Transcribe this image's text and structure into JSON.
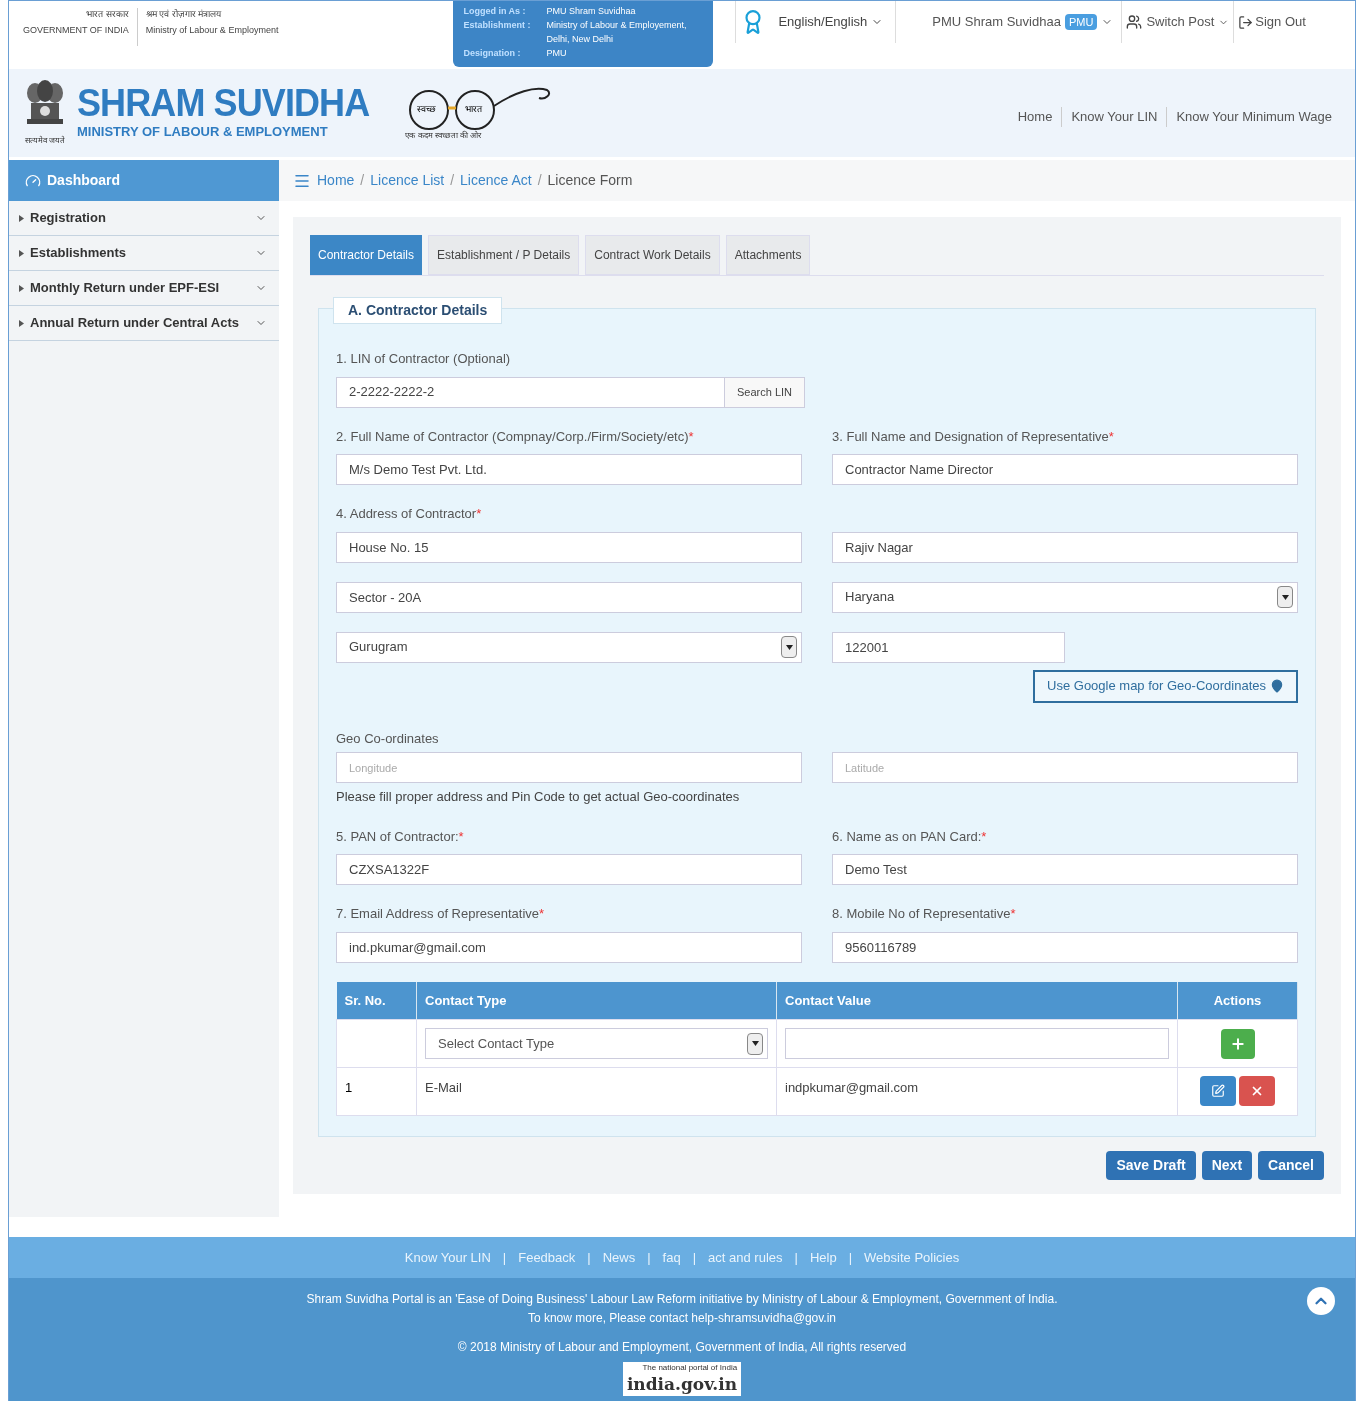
{
  "gov": {
    "hindi": "भारत सरकार",
    "english": "GOVERNMENT OF INDIA"
  },
  "ministry": {
    "hindi": "श्रम एवं रोज़गार मंत्रालय",
    "english": "Ministry of Labour & Employment"
  },
  "login_info": [
    {
      "label": "Logged in As :",
      "value": "PMU Shram Suvidhaa"
    },
    {
      "label": "Establishment :",
      "value": "Ministry of Labour & Employement, Delhi, New Delhi"
    },
    {
      "label": "Designation :",
      "value": "PMU"
    }
  ],
  "user_bar": {
    "language": "English/English",
    "user": "PMU Shram Suvidhaa",
    "badge": "PMU",
    "switch_post": "Switch Post",
    "sign_out": "Sign Out"
  },
  "brand": {
    "title": "SHRAM SUVIDHA",
    "subtitle": "MINISTRY OF LABOUR & EMPLOYMENT",
    "motto": "सत्यमेव जयते"
  },
  "swachh": {
    "left": "स्वच्छ",
    "right": "भारत",
    "tagline": "एक कदम स्वच्छता की ओर"
  },
  "top_nav": [
    "Home",
    "Know Your LIN",
    "Know Your Minimum Wage"
  ],
  "sidebar": {
    "header": "Dashboard",
    "items": [
      "Registration",
      "Establishments",
      "Monthly Return under EPF-ESI",
      "Annual Return under Central Acts"
    ]
  },
  "breadcrumb": [
    "Home",
    "Licence List",
    "Licence Act",
    "Licence Form"
  ],
  "breadcrumb_separator": "/",
  "required_mark": "*",
  "tabs": [
    {
      "label": "Contractor Details",
      "selected": true
    },
    {
      "label": "Establishment / P Details",
      "selected": false
    },
    {
      "label": "Contract Work Details",
      "selected": false
    },
    {
      "label": "Attachments",
      "selected": false
    }
  ],
  "section_title": "A. Contractor Details",
  "lin": {
    "label": "1. LIN of Contractor (Optional)",
    "value": "2-2222-2222-2",
    "button": "Search LIN"
  },
  "form_rows": [
    [
      {
        "kind": "text",
        "label": "2. Full Name of Contractor (Compnay/Corp./Firm/Society/etc)",
        "required": true,
        "value": "M/s Demo Test Pvt. Ltd."
      },
      {
        "kind": "text",
        "label": "3. Full Name and Designation of Representative",
        "required": true,
        "value": "Contractor Name Director"
      }
    ],
    [
      {
        "kind": "text",
        "label": "4. Address of Contractor",
        "required": true,
        "value": "House No. 15"
      },
      {
        "kind": "text",
        "value": "Rajiv Nagar"
      }
    ],
    [
      {
        "kind": "text",
        "value": "Sector - 20A"
      },
      {
        "kind": "select",
        "value": "Haryana"
      }
    ],
    [
      {
        "kind": "select",
        "value": "Gurugram"
      },
      {
        "kind": "short",
        "value": "122001"
      }
    ]
  ],
  "map_button": "Use Google map for Geo-Coordinates",
  "geo": {
    "label": "Geo Co-ordinates",
    "longitude_placeholder": "Longitude",
    "latitude_placeholder": "Latitude",
    "hint": "Please fill proper address and Pin Code to get actual Geo-coordinates"
  },
  "form_rows_2": [
    [
      {
        "kind": "text",
        "label": "5. PAN of Contractor:",
        "required": true,
        "value": "CZXSA1322F"
      },
      {
        "kind": "text",
        "label": "6. Name as on PAN Card:",
        "required": true,
        "value": "Demo Test"
      }
    ],
    [
      {
        "kind": "text",
        "label": "7. Email Address of Representative",
        "required": true,
        "value": "ind.pkumar@gmail.com"
      },
      {
        "kind": "text",
        "label": "8. Mobile No of Representative",
        "required": true,
        "value": "9560116789"
      }
    ]
  ],
  "contacts": {
    "columns": [
      "Sr. No.",
      "Contact Type",
      "Contact Value",
      "Actions"
    ],
    "type_placeholder": "Select Contact Type",
    "rows": [
      {
        "sr": "1",
        "type": "E-Mail",
        "value": "indpkumar@gmail.com"
      }
    ]
  },
  "actions": [
    "Save Draft",
    "Next",
    "Cancel"
  ],
  "footer": {
    "separator": "|",
    "links": [
      "Know Your LIN",
      "Feedback",
      "News",
      "faq",
      "act and rules",
      "Help",
      "Website Policies"
    ],
    "lines": [
      "Shram Suvidha Portal is an 'Ease of Doing Business' Labour Law Reform initiative by Ministry of Labour & Employment, Government of India.",
      "To know more, Please contact help-shramsuvidha@gov.in"
    ],
    "copyright": "© 2018 Ministry of Labour and Employment, Government of India, All rights reserved",
    "logo": {
      "caption": "The national portal of India",
      "text": "india.gov.in"
    }
  }
}
